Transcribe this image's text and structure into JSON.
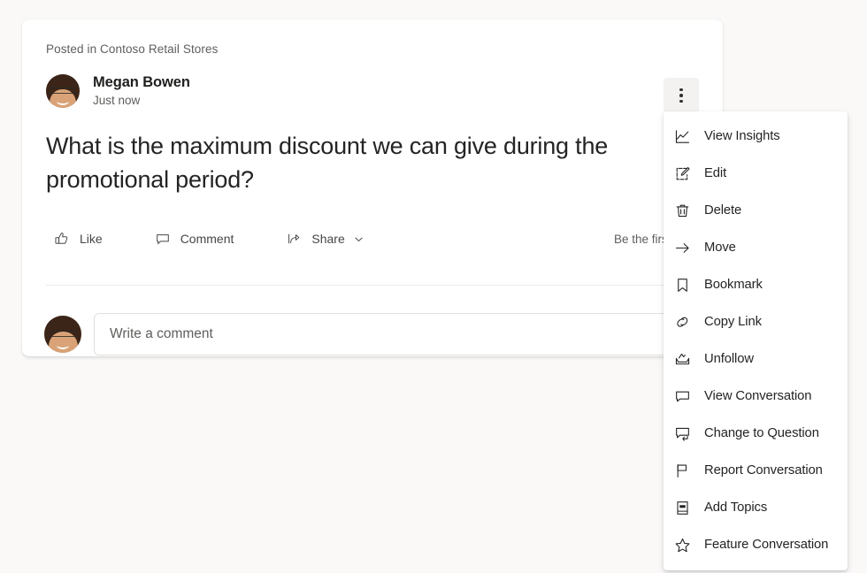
{
  "page": {
    "background_color": "#faf9f8"
  },
  "post": {
    "posted_in": "Posted in Contoso Retail Stores",
    "author_name": "Megan Bowen",
    "timestamp": "Just now",
    "body": "What is the maximum discount we can give during the promotional period?",
    "avatar_name": "megan-bowen-avatar",
    "actions": [
      {
        "icon": "thumbs-up-icon",
        "label": "Like"
      },
      {
        "icon": "comment-bubble-icon",
        "label": "Comment"
      },
      {
        "icon": "share-icon",
        "label": "Share",
        "has_chevron": true
      }
    ],
    "first_like_text": "Be the first to lik",
    "comment_placeholder": "Write a comment"
  },
  "overflow_button": {
    "name": "more-options-button",
    "background_color": "#f3f2f1"
  },
  "context_menu": {
    "items": [
      {
        "icon": "insights-chart-icon",
        "label": "View Insights"
      },
      {
        "icon": "edit-pencil-icon",
        "label": "Edit"
      },
      {
        "icon": "trash-icon",
        "label": "Delete"
      },
      {
        "icon": "arrow-right-icon",
        "label": "Move"
      },
      {
        "icon": "bookmark-icon",
        "label": "Bookmark"
      },
      {
        "icon": "link-icon",
        "label": "Copy Link"
      },
      {
        "icon": "unfollow-inbox-icon",
        "label": "Unfollow"
      },
      {
        "icon": "conversation-icon",
        "label": "View Conversation"
      },
      {
        "icon": "change-question-icon",
        "label": "Change to Question"
      },
      {
        "icon": "flag-icon",
        "label": "Report Conversation"
      },
      {
        "icon": "topics-book-icon",
        "label": "Add Topics"
      },
      {
        "icon": "star-icon",
        "label": "Feature Conversation"
      }
    ]
  }
}
